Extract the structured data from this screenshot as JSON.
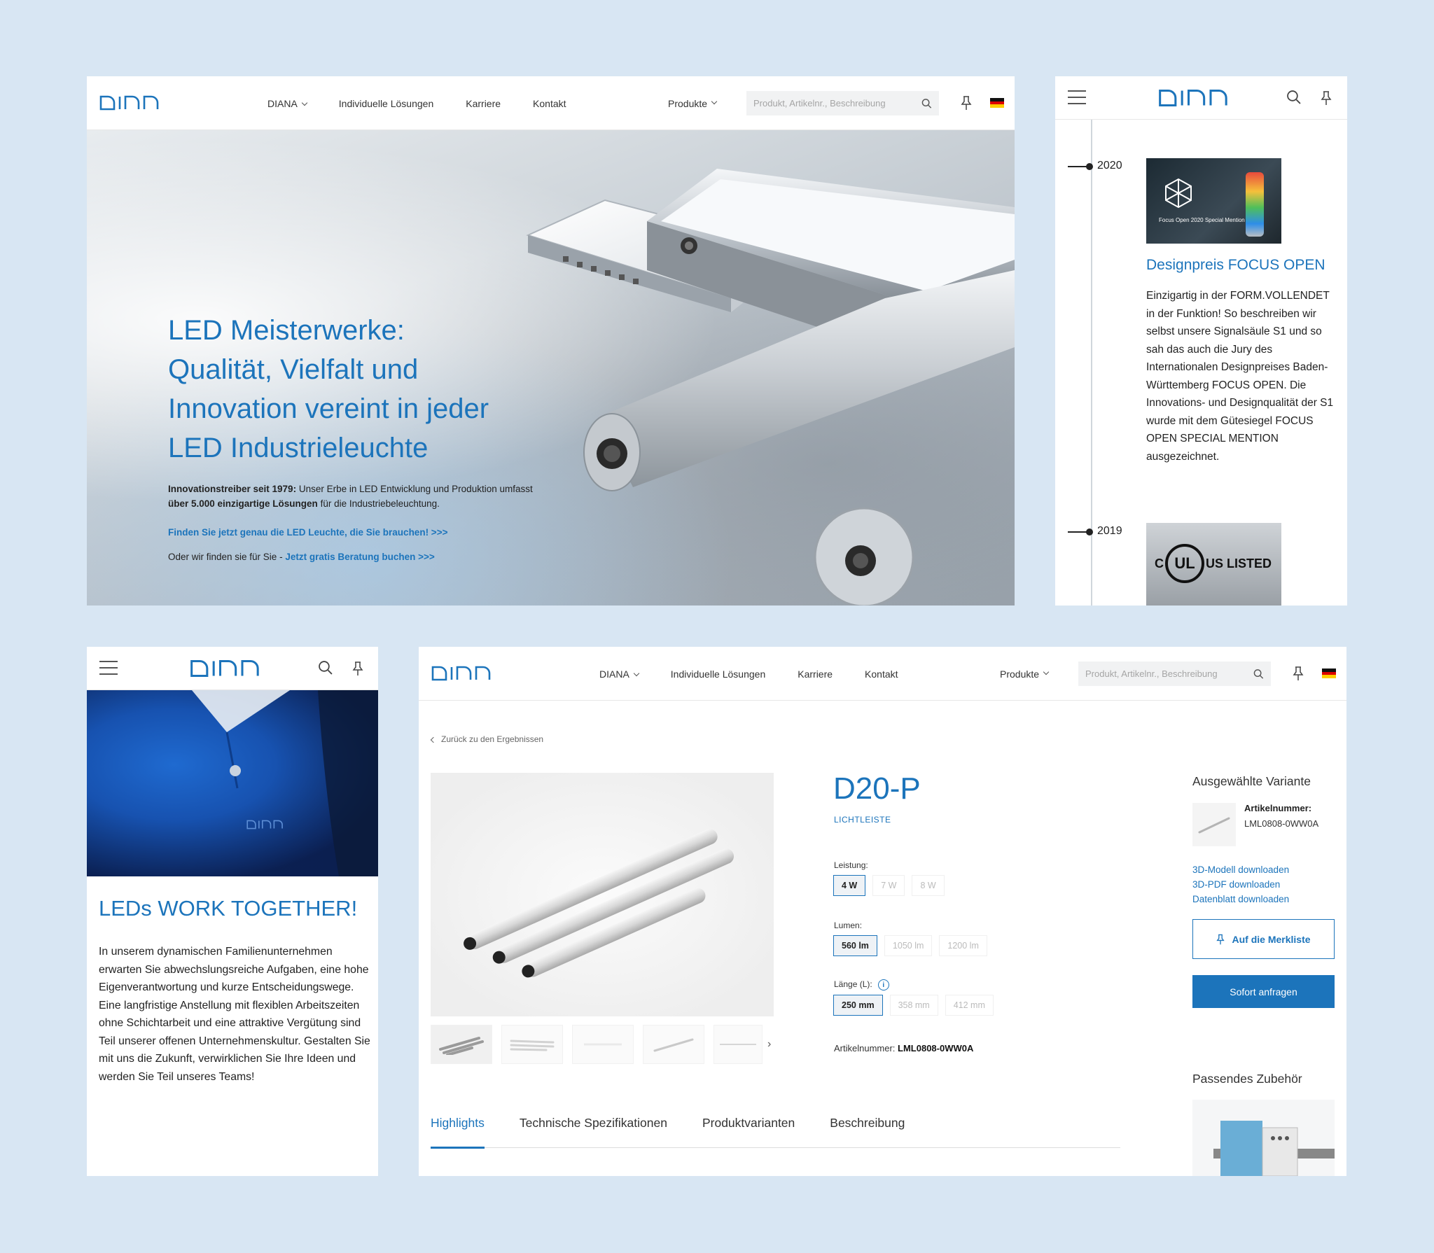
{
  "brand": {
    "logo_text": "DIANA"
  },
  "desktop_header": {
    "nav": [
      "DIANA",
      "Individuelle Lösungen",
      "Karriere",
      "Kontakt"
    ],
    "products": "Produkte",
    "search_placeholder": "Produkt, Artikelnr., Beschreibung"
  },
  "hero": {
    "title_lines": [
      "LED Meisterwerke:",
      "Qualität, Vielfalt und",
      "Innovation vereint in jeder",
      "LED Industrieleuchte"
    ],
    "intro_bold1": "Innovationstreiber seit 1979:",
    "intro_text1": " Unser Erbe in LED Entwicklung und Produktion umfasst",
    "intro_bold2": "über 5.000 einzigartige Lösungen",
    "intro_text2": " für die Industriebeleuchtung.",
    "link1": "Finden Sie jetzt genau die LED Leuchte, die Sie brauchen! >>>",
    "link2_prefix": "Oder wir finden sie für Sie - ",
    "link2": "Jetzt gratis Beratung buchen >>>"
  },
  "timeline": {
    "entries": [
      {
        "year": "2020",
        "image_caption": "Focus Open 2020 Special Mention"
      },
      {
        "year": "2019",
        "image_caption": "US LISTED"
      }
    ],
    "heading": "Designpreis FOCUS OPEN",
    "text": "Einzigartig in der FORM.VOLLENDET in der Funktion! So beschreiben wir selbst unsere Signalsäule S1 und so sah das auch die Jury des Internationalen Designpreises Baden-Württemberg FOCUS OPEN. Die Innovations- und Designqualität der S1 wurde mit dem Gütesiegel FOCUS OPEN SPECIAL MENTION ausgezeichnet."
  },
  "career": {
    "heading": "LEDs WORK TOGETHER!",
    "text": "In unserem dynamischen Familienunternehmen erwarten Sie abwechslungsreiche Aufgaben, eine hohe Eigenverantwortung und kurze Entscheidungswege. Eine langfristige Anstellung mit flexiblen Arbeitszeiten ohne Schichtarbeit und eine attraktive Vergütung sind Teil unserer offenen Unternehmenskultur. Gestalten Sie mit uns die Zukunft, verwirklichen Sie Ihre Ideen und werden Sie Teil unseres Teams!"
  },
  "product": {
    "back": "Zurück zu den Ergebnissen",
    "title": "D20-P",
    "category": "LICHTLEISTE",
    "leistung_label": "Leistung:",
    "leistung": [
      "4 W",
      "7 W",
      "8 W"
    ],
    "lumen_label": "Lumen:",
    "lumen": [
      "560 lm",
      "1050 lm",
      "1200 lm"
    ],
    "laenge_label": "Länge (L):",
    "laenge": [
      "250 mm",
      "358 mm",
      "412 mm"
    ],
    "artnr_label": "Artikelnummer: ",
    "artnr": "LML0808-0WW0A",
    "tabs": [
      "Highlights",
      "Technische Spezifikationen",
      "Produktvarianten",
      "Beschreibung"
    ],
    "variant_heading": "Ausgewählte Variante",
    "variant_label": "Artikelnummer:",
    "variant_value": "LML0808-0WW0A",
    "downloads": [
      "3D-Modell downloaden",
      "3D-PDF downloaden",
      "Datenblatt downloaden"
    ],
    "merkliste": "Auf die Merkliste",
    "anfragen": "Sofort anfragen",
    "accessories_heading": "Passendes Zubehör"
  },
  "colors": {
    "brand_blue": "#1c74bb",
    "background": "#d8e6f3"
  }
}
